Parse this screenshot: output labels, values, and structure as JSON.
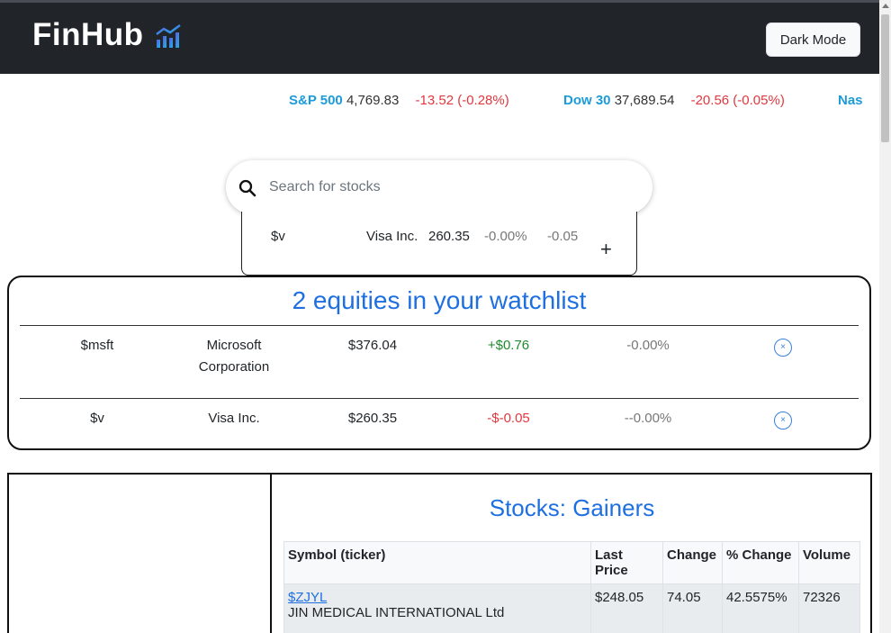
{
  "header": {
    "brand": "FinHub",
    "dark_mode_label": "Dark Mode"
  },
  "ticker": [
    {
      "name": "S&P 500",
      "value": "4,769.83",
      "change": "-13.52 (-0.28%)"
    },
    {
      "name": "Dow 30",
      "value": "37,689.54",
      "change": "-20.56 (-0.05%)"
    },
    {
      "name": "Nas",
      "value": "",
      "change": ""
    }
  ],
  "search": {
    "placeholder": "Search for stocks",
    "value": "",
    "suggestion": {
      "symbol": "$v",
      "name": "Visa Inc.",
      "price": "260.35",
      "pct": "-0.00%",
      "change": "-0.05",
      "add": "+"
    }
  },
  "watchlist": {
    "title": "2 equities in your watchlist",
    "rows": [
      {
        "symbol": "$msft",
        "name": "Microsoft Corporation",
        "price": "$376.04",
        "change": "+$0.76",
        "pct": "-0.00%",
        "remove": "×"
      },
      {
        "symbol": "$v",
        "name": "Visa Inc.",
        "price": "$260.35",
        "change": "-$-0.05",
        "pct": "--0.00%",
        "remove": "×"
      }
    ]
  },
  "gainers": {
    "title": "Stocks: Gainers",
    "columns": [
      "Symbol (ticker)",
      "Last Price",
      "Change",
      "% Change",
      "Volume"
    ],
    "rows": [
      {
        "symbol": "$ZJYL",
        "name": "JIN MEDICAL INTERNATIONAL Ltd",
        "price": "$248.05",
        "change": "74.05",
        "pct": "42.5575%",
        "volume": "72326"
      }
    ]
  },
  "colors": {
    "header_bg": "#212529",
    "accent_blue": "#1e6fe0",
    "ticker_blue": "#1d9bd9",
    "negative": "#e0383e",
    "positive": "#1e8a2e"
  }
}
